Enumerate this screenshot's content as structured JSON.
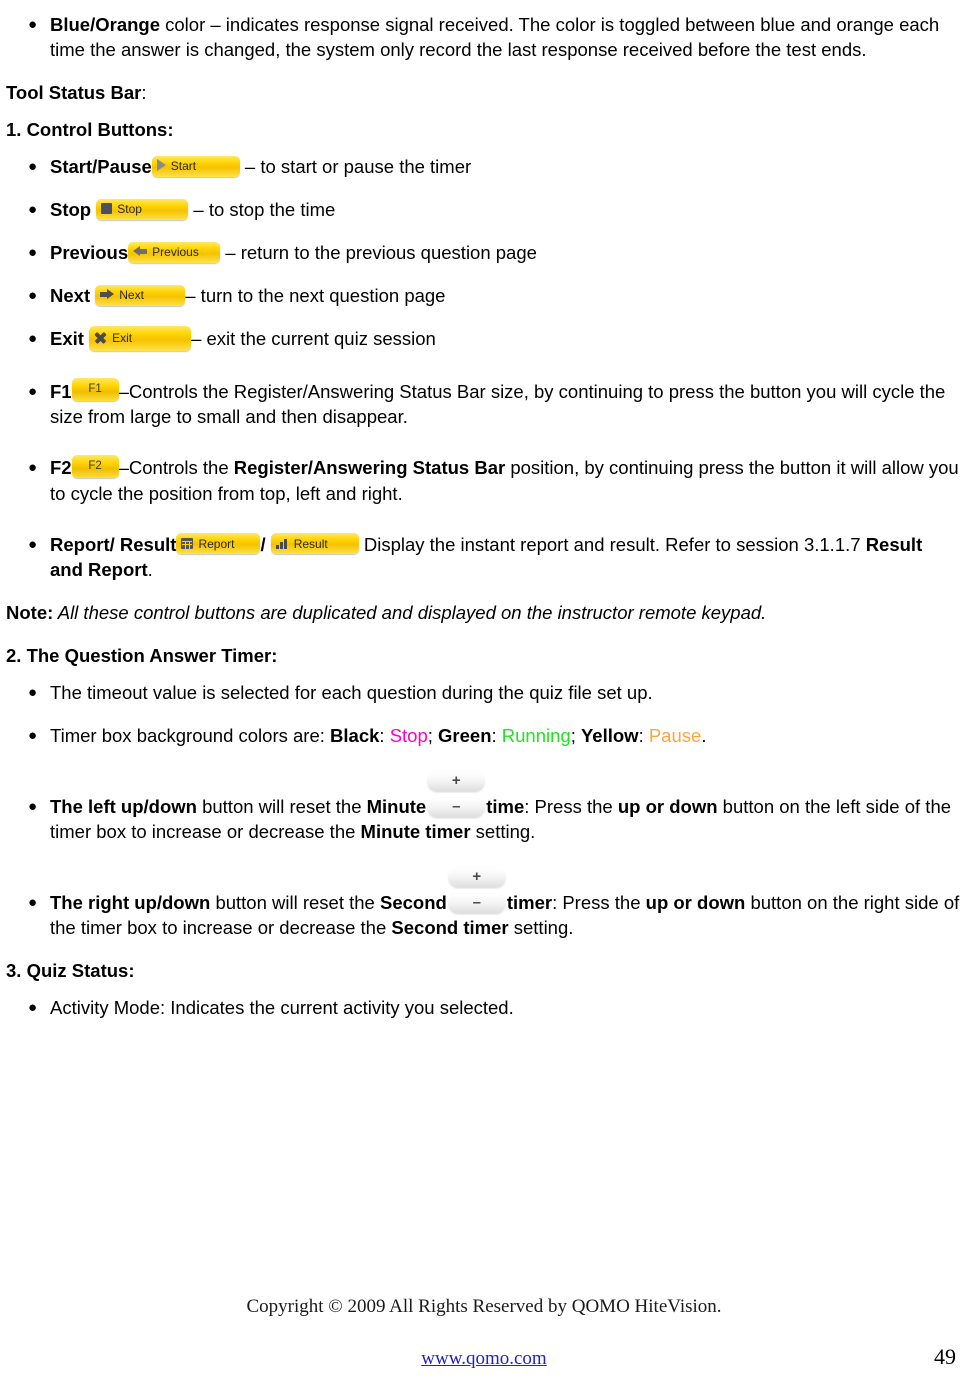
{
  "document": {
    "intro_bullet": {
      "lead": "Blue/Orange",
      "text": " color – indicates response signal received. The color is toggled between blue and orange each time the answer is changed, the system only record the last response received before the test ends."
    },
    "section_tool_status_bar": "Tool Status Bar",
    "section_tool_status_bar_colon": ":",
    "section_1_title": "1. Control Buttons:",
    "control_buttons": [
      {
        "label": "Start/Pause",
        "button": {
          "name": "start-button",
          "text": "Start",
          "icon": "play-icon"
        },
        "description": " – to start or pause the timer"
      },
      {
        "label": "Stop",
        "button": {
          "name": "stop-button",
          "text": "Stop",
          "icon": "square-stop-icon"
        },
        "description": " – to stop the time"
      },
      {
        "label": "Previous",
        "button": {
          "name": "previous-button",
          "text": "Previous",
          "icon": "arrow-left-icon"
        },
        "description": " – return to the previous question page"
      },
      {
        "label": "Next",
        "button": {
          "name": "next-button",
          "text": "Next",
          "icon": "arrow-right-icon"
        },
        "description": "– turn to the next question page"
      },
      {
        "label": "Exit",
        "button": {
          "name": "exit-button",
          "text": "Exit",
          "icon": "x-close-icon"
        },
        "description": "– exit the current quiz session"
      }
    ],
    "f1_item": {
      "label": "F1",
      "button_text": "F1",
      "text_part1": "–Controls the Register/Answering Status Bar size, by continuing to press the button you will cycle the size from large to small and then disappear."
    },
    "f2_item": {
      "label": "F2",
      "button_text": "F2",
      "text_a": "–Controls the ",
      "text_bold": "Register/Answering Status Bar",
      "text_b": " position, by continuing press the button it will allow you to cycle the position from top, left and right."
    },
    "report_item": {
      "label": "Report/ Result",
      "report_button_text": "Report",
      "separator": "/",
      "result_button_text": "Result",
      "text_a": " Display the instant report and result. Refer to session 3.1.1.7 ",
      "text_bold": "Result and Report",
      "text_b": "."
    },
    "note": {
      "label": "Note:",
      "text": " All these control buttons are duplicated and displayed on the instructor remote keypad."
    },
    "section_2_title": "2. The Question Answer Timer:",
    "timer_bullets": {
      "timeout": "The timeout value is selected for each question during the quiz file set up.",
      "colors_lead": "Timer box background colors are: ",
      "black_label": "Black",
      "stop_value": "Stop",
      "green_label": "Green",
      "running_value": "Running",
      "yellow_label": "Yellow",
      "pause_value": "Pause",
      "sep1": ": ",
      "sep2": "; ",
      "end": "."
    },
    "left_updown": {
      "bold_lead": "The left up/down",
      "text_a": " button will reset the ",
      "bold_minute": "Minute",
      "stepper_plus": "+",
      "stepper_minus": "–",
      "bold_time": "time",
      "text_b": ": Press the ",
      "bold_updown": "up or down",
      "text_c": " button on the left side of the timer box to increase or decrease the ",
      "bold_minute_timer": "Minute timer",
      "text_d": " setting."
    },
    "right_updown": {
      "bold_lead": "The right up/down",
      "text_a": " button will reset the ",
      "bold_second": "Second",
      "stepper_plus": "+",
      "stepper_minus": "–",
      "bold_timer": "timer",
      "text_b": ": Press the ",
      "bold_updown": "up or down",
      "text_c": " button on the right side of the timer box to increase or decrease the ",
      "bold_second_timer": "Second timer",
      "text_d": " setting."
    },
    "section_3_title": "3. Quiz Status:",
    "quiz_status_bullet": "Activity Mode: Indicates the current activity you selected.",
    "footer": {
      "copyright": "Copyright © 2009 All Rights Reserved by QOMO HiteVision.",
      "url": "www.qomo.com",
      "page_number": "49"
    },
    "colors": {
      "stop": "#FF00CC",
      "running": "#1FE41F",
      "pause": "#FFA340",
      "button_yellow": "#FFD400",
      "link_blue": "#2222CC"
    }
  }
}
